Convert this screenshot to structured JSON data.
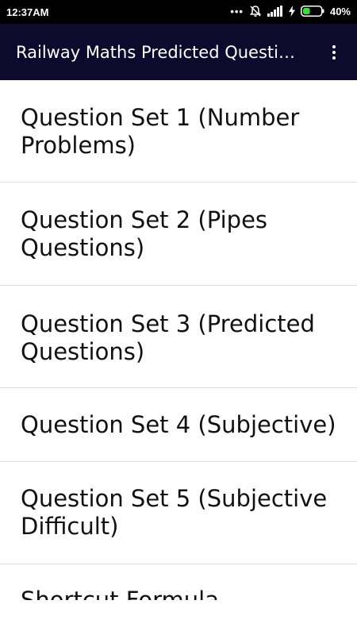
{
  "status_bar": {
    "time": "12:37AM",
    "battery_percent": "40%",
    "battery_level": 0.4,
    "icons": [
      "more-dots-icon",
      "notifications-off-icon",
      "signal-icon",
      "charging-icon",
      "battery-icon"
    ]
  },
  "app_bar": {
    "title": "Railway Maths Predicted Questions",
    "background_color": "#0c0b2d",
    "menu_icon": "overflow-menu-icon"
  },
  "list": {
    "items": [
      {
        "label": "Question Set 1 (Number Problems)"
      },
      {
        "label": "Question Set 2 (Pipes Questions)"
      },
      {
        "label": "Question Set 3 (Predicted Questions)"
      },
      {
        "label": "Question Set 4 (Subjective)"
      },
      {
        "label": "Question Set 5 (Subjective Difficult)"
      },
      {
        "label": "Shortcut Formula"
      }
    ]
  }
}
